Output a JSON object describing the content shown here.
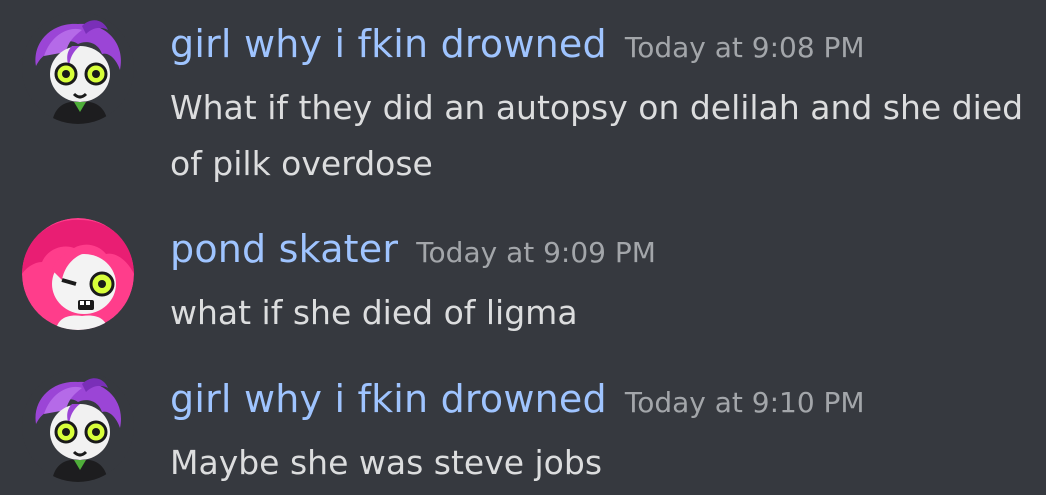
{
  "messages": [
    {
      "username": "girl why i fkin drowned",
      "timestamp": "Today at 9:08 PM",
      "lines": [
        "What if they did an autopsy on delilah and she died",
        "of pilk overdose"
      ],
      "avatar_icon": "purple-haired-character-avatar"
    },
    {
      "username": "pond skater",
      "timestamp": "Today at 9:09 PM",
      "lines": [
        "what if she died of ligma"
      ],
      "avatar_icon": "pink-haired-character-avatar"
    },
    {
      "username": "girl why i fkin drowned",
      "timestamp": "Today at 9:10 PM",
      "lines": [
        "Maybe she was steve jobs"
      ],
      "avatar_icon": "purple-haired-character-avatar"
    }
  ],
  "colors": {
    "background": "#36393f",
    "username": "#9fc4ff",
    "timestamp": "#a3a6aa",
    "text": "#dcddde"
  }
}
